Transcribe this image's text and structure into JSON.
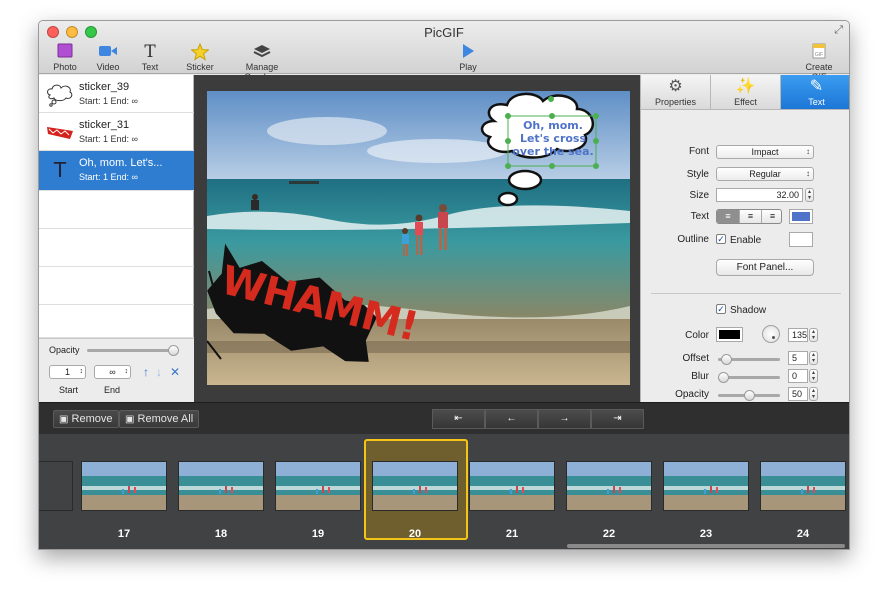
{
  "window": {
    "title": "PicGIF",
    "traffic_colors": [
      "#fc605b",
      "#fdbc40",
      "#34c84a"
    ]
  },
  "toolbar": {
    "photo_label": "Photo",
    "video_label": "Video",
    "text_label": "Text",
    "text_icon_glyph": "T",
    "sticker_label": "Sticker",
    "manage_overlays_label": "Manage Overlays",
    "play_label": "Play",
    "create_gif_label": "Create GIF"
  },
  "sidebar": {
    "items": [
      {
        "name": "sticker_39",
        "detail": "Start: 1 End: ∞",
        "thumb": "cloud-sticker-icon"
      },
      {
        "name": "sticker_31",
        "detail": "Start: 1 End: ∞",
        "thumb": "whamm-sticker-icon"
      },
      {
        "name": "Oh, mom. Let's...",
        "detail": "Start: 1 End: ∞",
        "thumb": "text-overlay-icon",
        "glyph": "T",
        "selected": true
      }
    ],
    "opacity_label": "Opacity",
    "opacity_value": 1.0,
    "start_value": "1",
    "end_value": "∞",
    "start_label": "Start",
    "end_label": "End"
  },
  "canvas": {
    "bubble_text": "Oh, mom. Let's cross over the sea.",
    "sticker_text": "WHAMM!"
  },
  "inspector": {
    "tabs": [
      {
        "label": "Properties",
        "icon": "gear-icon"
      },
      {
        "label": "Effect",
        "icon": "magic-wand-icon"
      },
      {
        "label": "Text",
        "icon": "pencil-icon",
        "active": true
      }
    ],
    "font_label": "Font",
    "font_value": "Impact",
    "style_label": "Style",
    "style_value": "Regular",
    "size_label": "Size",
    "size_value": "32.00",
    "text_label": "Text",
    "text_color": "#4f73c9",
    "outline_label": "Outline",
    "outline_enable_label": "Enable",
    "outline_checked": true,
    "outline_color": "#ffffff",
    "font_panel_label": "Font Panel...",
    "shadow_label": "Shadow",
    "shadow_checked": true,
    "color_label": "Color",
    "shadow_color": "#000000",
    "angle_value": "135",
    "offset_label": "Offset",
    "offset_value": "5",
    "blur_label": "Blur",
    "blur_value": "0",
    "opacity_label": "Opacity",
    "opacity_value": "50",
    "check_glyph": "✓"
  },
  "timeline": {
    "remove_label": "Remove",
    "remove_all_label": "Remove All",
    "nav": {
      "first": "⇤",
      "prev": "←",
      "next": "→",
      "last": "⇥"
    }
  },
  "filmstrip": {
    "frames": [
      "17",
      "18",
      "19",
      "20",
      "21",
      "22",
      "23",
      "24"
    ],
    "selected_frame": "20"
  }
}
